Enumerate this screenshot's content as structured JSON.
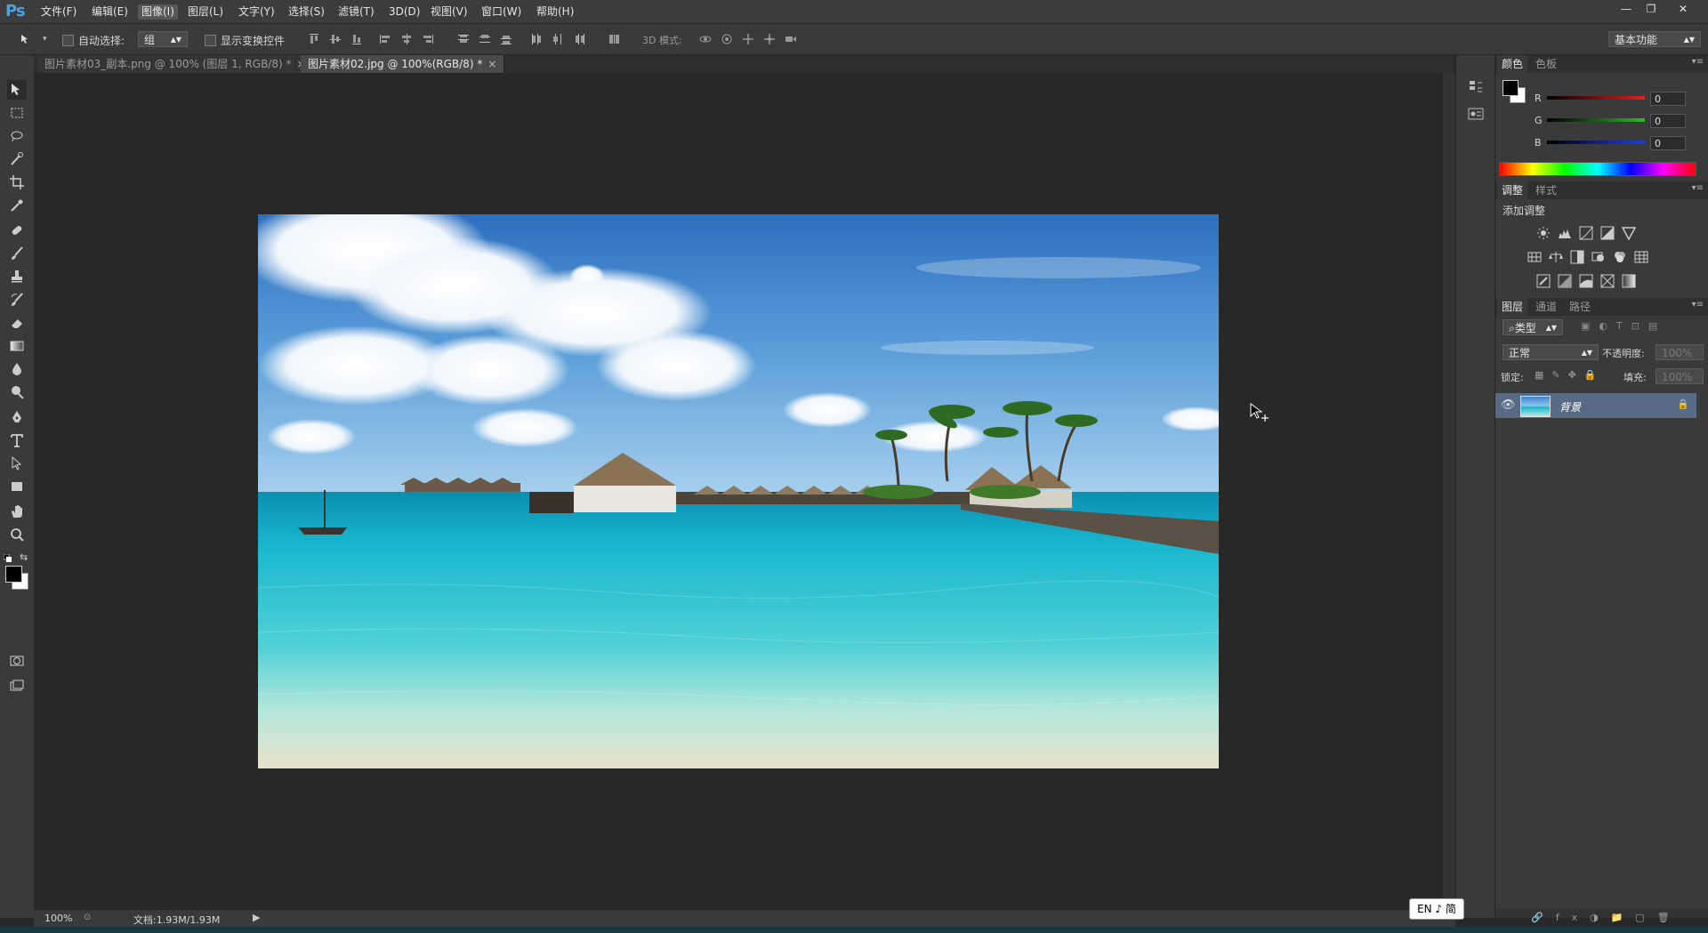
{
  "app": {
    "logo": "Ps"
  },
  "menu": [
    "文件(F)",
    "编辑(E)",
    "图像(I)",
    "图层(L)",
    "文字(Y)",
    "选择(S)",
    "滤镜(T)",
    "3D(D)",
    "视图(V)",
    "窗口(W)",
    "帮助(H)"
  ],
  "options": {
    "auto_select_label": "自动选择:",
    "auto_select_value": "组",
    "show_transform_label": "显示变换控件",
    "mode_3d_label": "3D 模式:",
    "workspace": "基本功能"
  },
  "tabs": [
    {
      "label": "图片素材03_副本.png @ 100% (图层 1, RGB/8) *",
      "close": "×"
    },
    {
      "label": "图片素材02.jpg @ 100%(RGB/8) *",
      "close": "×"
    }
  ],
  "status": {
    "zoom": "100%",
    "doc": "文档:1.93M/1.93M"
  },
  "color_panel": {
    "tabs": [
      "颜色",
      "色板"
    ],
    "channels": [
      {
        "label": "R",
        "value": "0",
        "color": "#e0201a"
      },
      {
        "label": "G",
        "value": "0",
        "color": "#2eb82e"
      },
      {
        "label": "B",
        "value": "0",
        "color": "#2040e0"
      }
    ]
  },
  "adjust_panel": {
    "tabs": [
      "调整",
      "样式"
    ],
    "title": "添加调整"
  },
  "layers_panel": {
    "tabs": [
      "图层",
      "通道",
      "路径"
    ],
    "filter": "类型",
    "blend": "正常",
    "opacity_label": "不透明度:",
    "opacity_value": "100%",
    "lock_label": "锁定:",
    "fill_label": "填充:",
    "fill_value": "100%",
    "layer_name": "背景"
  },
  "ime": "EN ♪ 简",
  "colors": {
    "accent": "#4aa3df",
    "panel": "#3a3a3a",
    "canvas_bg": "#282828"
  }
}
